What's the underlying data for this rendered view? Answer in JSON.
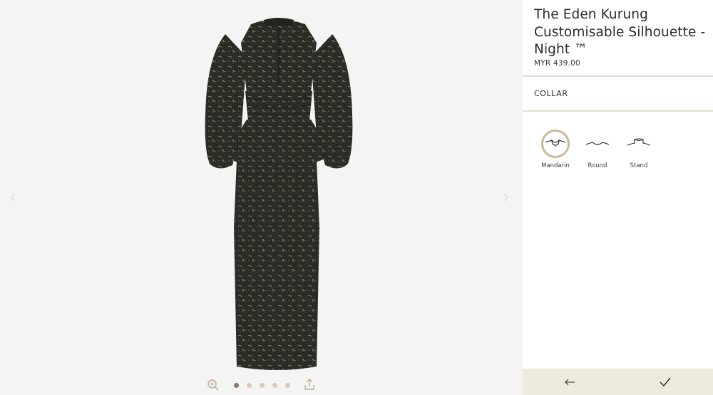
{
  "product": {
    "title": "The Eden Kurung Customisable Silhouette - Night ™",
    "price": "MYR 439.00"
  },
  "section": {
    "label": "COLLAR"
  },
  "collar_options": [
    {
      "label": "Mandarin",
      "icon": "mandarin-collar-icon",
      "selected": true
    },
    {
      "label": "Round",
      "icon": "round-collar-icon",
      "selected": false
    },
    {
      "label": "Stand",
      "icon": "stand-collar-icon",
      "selected": false
    }
  ],
  "viewer": {
    "image_count": 5,
    "active_image": 1,
    "icons": {
      "prev": "chevron-left-icon",
      "next": "chevron-right-icon",
      "zoom": "zoom-in-icon",
      "share": "share-icon"
    }
  },
  "footer": {
    "icons": {
      "back": "arrow-left-icon",
      "confirm": "checkmark-icon"
    }
  },
  "colors": {
    "accent": "#cdb896",
    "divider": "#e7ddd0",
    "footer_bg": "#efeade",
    "dot_active": "#8a7b67",
    "dot_inactive": "#d9cbb6",
    "garment": "#2c2d27"
  }
}
